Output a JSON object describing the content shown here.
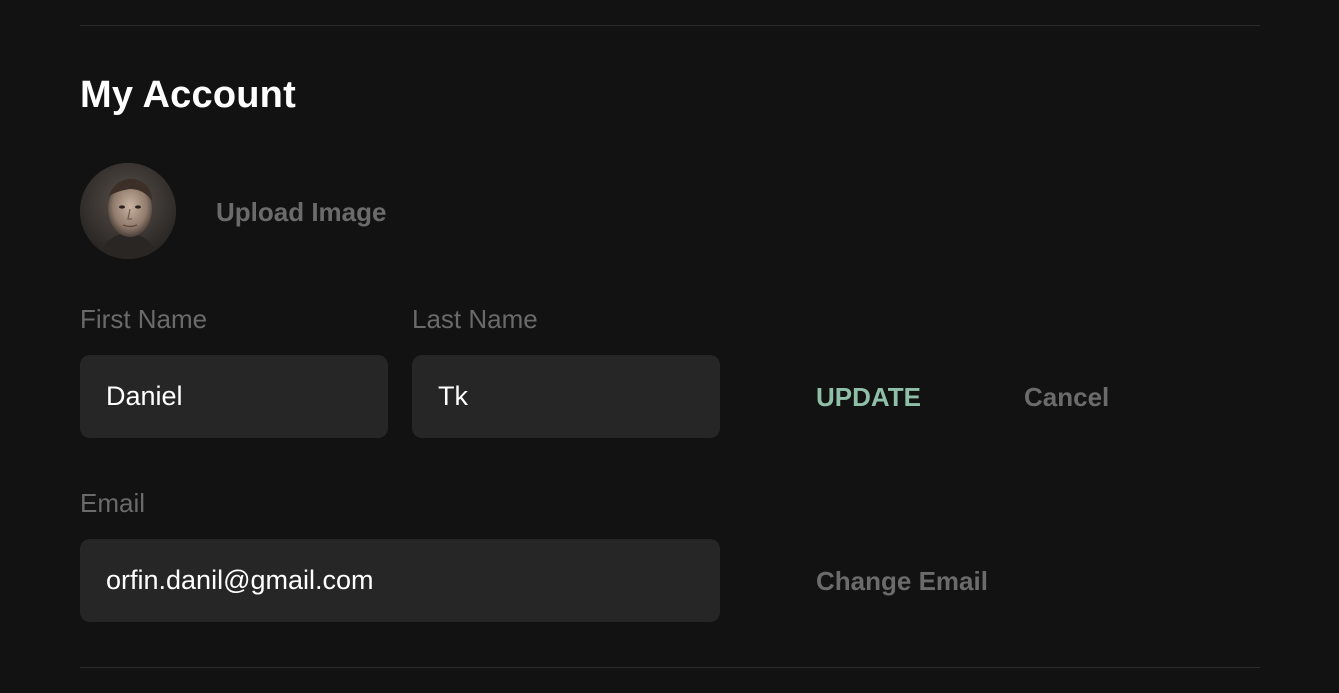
{
  "section": {
    "title": "My Account"
  },
  "avatar": {
    "upload_label": "Upload Image"
  },
  "name_form": {
    "first_name_label": "First Name",
    "first_name_value": "Daniel",
    "last_name_label": "Last Name",
    "last_name_value": "Tk",
    "update_label": "UPDATE",
    "cancel_label": "Cancel"
  },
  "email_form": {
    "email_label": "Email",
    "email_value": "orfin.danil@gmail.com",
    "change_email_label": "Change Email"
  },
  "colors": {
    "background": "#121212",
    "field_background": "#262626",
    "accent": "#8fbfa9",
    "muted_text": "#6b6b6b"
  }
}
